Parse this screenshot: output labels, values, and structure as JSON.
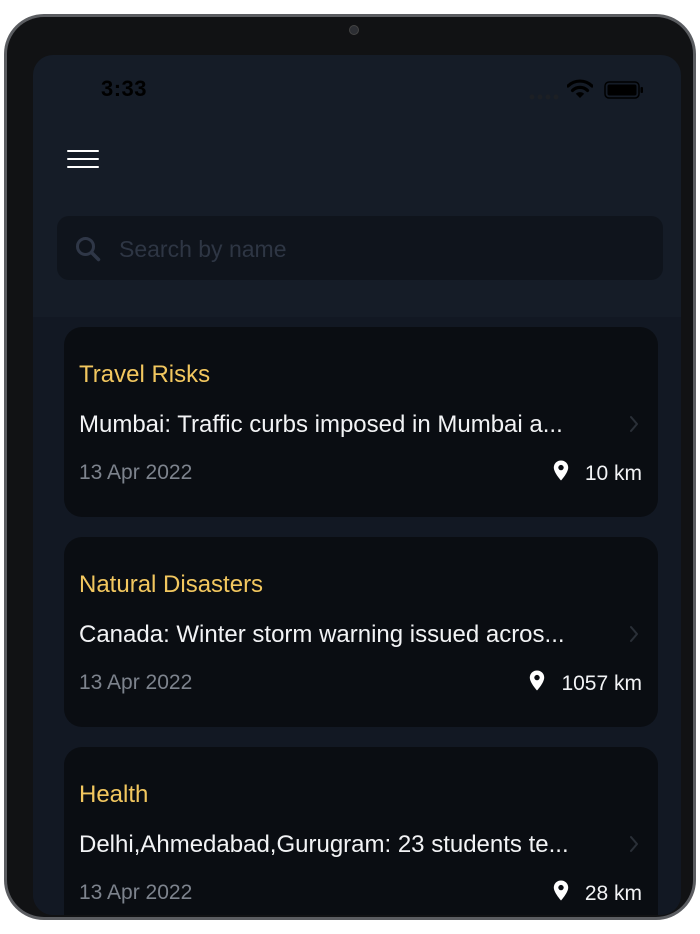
{
  "status_bar": {
    "time": "3:33"
  },
  "colors": {
    "screen_background": "#151c27",
    "card_background": "#0a0d12",
    "category_accent": "#f2c75f",
    "date_text": "#7d838d"
  },
  "header": {
    "menu_icon": "hamburger-menu-icon"
  },
  "search": {
    "placeholder": "Search by name",
    "value": ""
  },
  "alerts": [
    {
      "category": "Travel Risks",
      "title": "Mumbai: Traffic curbs imposed in Mumbai a...",
      "date": "13 Apr 2022",
      "distance": "10 km"
    },
    {
      "category": "Natural Disasters",
      "title": "Canada: Winter storm warning issued acros...",
      "date": "13 Apr 2022",
      "distance": "1057 km"
    },
    {
      "category": "Health",
      "title": "Delhi,Ahmedabad,Gurugram: 23 students te...",
      "date": "13 Apr 2022",
      "distance": "28 km"
    }
  ]
}
